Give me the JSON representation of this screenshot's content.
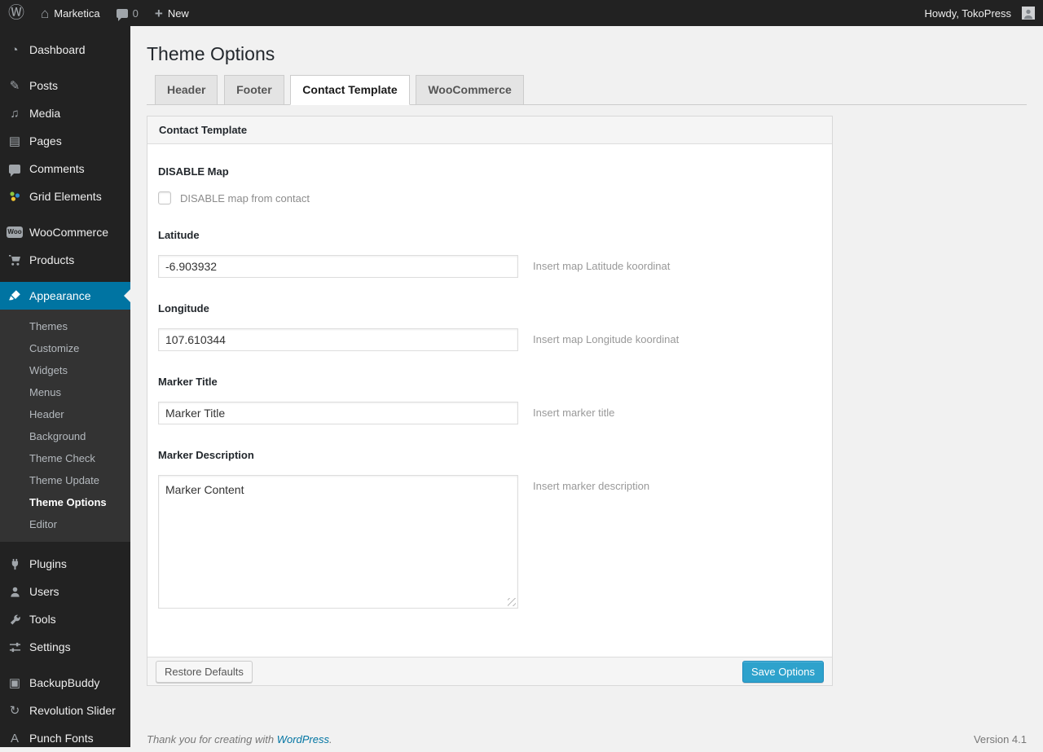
{
  "admin_bar": {
    "wp_logo_glyph": "Ⓦ",
    "home_glyph": "⌂",
    "site_name": "Marketica",
    "comment_count": "0",
    "plus": "+",
    "new_label": "New",
    "howdy": "Howdy, TokoPress"
  },
  "sidebar": {
    "items": [
      {
        "label": "Dashboard",
        "glyph": "◔"
      },
      {
        "label": "Posts",
        "glyph": "✎"
      },
      {
        "label": "Media",
        "glyph": "♫"
      },
      {
        "label": "Pages",
        "glyph": "▤"
      },
      {
        "label": "Comments"
      },
      {
        "label": "Grid Elements"
      },
      {
        "label": "WooCommerce",
        "badge": "Woo"
      },
      {
        "label": "Products"
      },
      {
        "label": "Appearance"
      },
      {
        "label": "Plugins"
      },
      {
        "label": "Users"
      },
      {
        "label": "Tools"
      },
      {
        "label": "Settings"
      },
      {
        "label": "BackupBuddy",
        "glyph": "▣"
      },
      {
        "label": "Revolution Slider",
        "glyph": "↻"
      },
      {
        "label": "Punch Fonts",
        "glyph": "A"
      }
    ],
    "appearance_submenu": [
      {
        "label": "Themes"
      },
      {
        "label": "Customize"
      },
      {
        "label": "Widgets"
      },
      {
        "label": "Menus"
      },
      {
        "label": "Header"
      },
      {
        "label": "Background"
      },
      {
        "label": "Theme Check"
      },
      {
        "label": "Theme Update"
      },
      {
        "label": "Theme Options"
      },
      {
        "label": "Editor"
      }
    ]
  },
  "page": {
    "title": "Theme Options"
  },
  "tabs": [
    {
      "label": "Header"
    },
    {
      "label": "Footer"
    },
    {
      "label": "Contact Template"
    },
    {
      "label": "WooCommerce"
    }
  ],
  "panel": {
    "title": "Contact Template",
    "disable_map": {
      "label": "DISABLE Map",
      "checkbox_label": "DISABLE map from contact",
      "checked": false
    },
    "latitude": {
      "label": "Latitude",
      "value": "-6.903932",
      "hint": "Insert map Latitude koordinat"
    },
    "longitude": {
      "label": "Longitude",
      "value": "107.610344",
      "hint": "Insert map Longitude koordinat"
    },
    "marker_title": {
      "label": "Marker Title",
      "value": "Marker Title",
      "hint": "Insert marker title"
    },
    "marker_description": {
      "label": "Marker Description",
      "value": "Marker Content",
      "hint": "Insert marker description"
    },
    "restore_button": "Restore Defaults",
    "save_button": "Save Options"
  },
  "footer": {
    "thanks_prefix": "Thank you for creating with ",
    "wordpress_link": "WordPress",
    "thanks_suffix": ".",
    "version": "Version 4.1"
  },
  "colors": {
    "accent_blue": "#2ea2cc",
    "menu_highlight": "#0074a2",
    "admin_dark": "#222222",
    "content_bg": "#f1f1f1"
  }
}
